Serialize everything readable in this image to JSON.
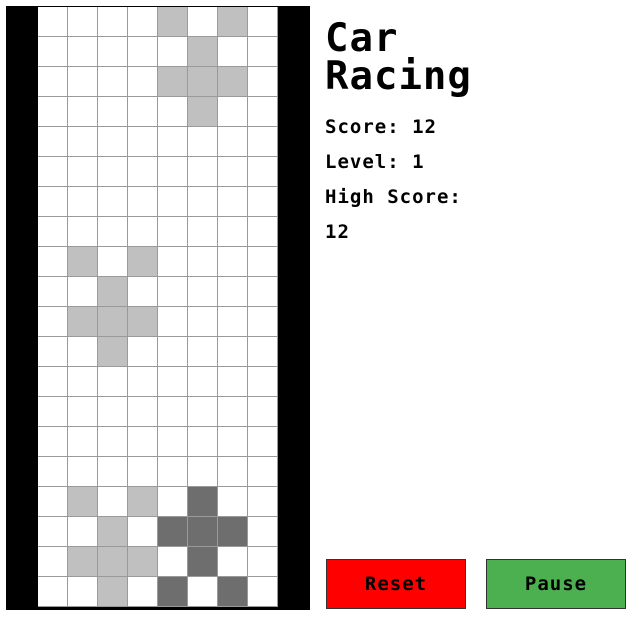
{
  "game": {
    "title": "Car Racing",
    "score_label": "Score:",
    "score": "12",
    "level_label": "Level:",
    "level": "1",
    "high_score_label": "High Score:",
    "high_score": "12"
  },
  "buttons": {
    "reset_label": "Reset",
    "pause_label": "Pause",
    "reset_color": "#ff0000",
    "pause_color": "#4caf50"
  },
  "board": {
    "columns": 8,
    "rows": 20,
    "colors": {
      "empty": "#ffffff",
      "enemy": "#c0c0c0",
      "player": "#6e6e6e",
      "border": "#000000"
    },
    "cells": [
      "....E.E.",
      ".....E..",
      "....EEE.",
      ".....E..",
      "........",
      "........",
      "........",
      "........",
      ".E.E....",
      "..E.....",
      ".EEE....",
      "..E.....",
      "........",
      "........",
      "........",
      "........",
      ".E.E.P..",
      "..E.PPP.",
      ".EEE.P..",
      "..E.P.P."
    ]
  }
}
